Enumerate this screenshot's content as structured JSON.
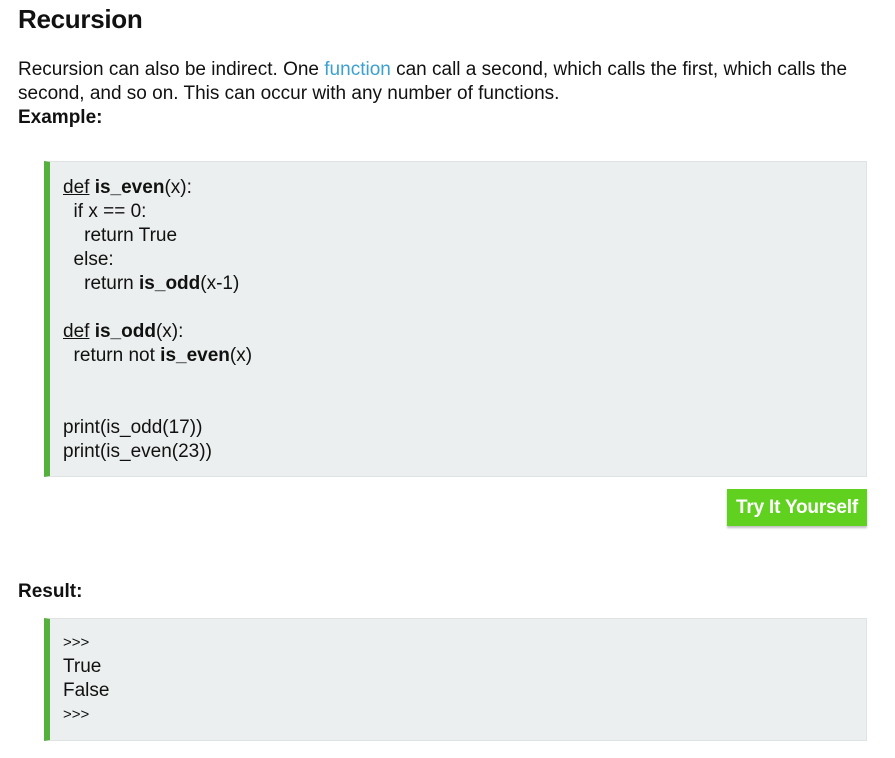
{
  "section": {
    "title": "Recursion",
    "intro_before": "Recursion can also be indirect. One ",
    "intro_link": "function",
    "intro_after": " can call a second, which calls the first, which calls the second, and so on. This can occur with any number of functions.",
    "example_label": "Example:",
    "result_label": "Result:"
  },
  "code": {
    "def_kw": "def",
    "fn_is_even": "is_even",
    "fn_is_odd": "is_odd",
    "line1_tail": "(x):",
    "line2": "  if x == 0:",
    "line3": "    return True",
    "line4": "  else:",
    "line5_pre": "    return ",
    "line5_tail": "(x-1)",
    "line7_tail": "(x):",
    "line8_pre": "  return not ",
    "line8_tail": "(x)",
    "print1": "print(is_odd(17))",
    "print2": "print(is_even(23))"
  },
  "button": {
    "label": "Try It Yourself"
  },
  "result": {
    "prompt1": ">>>",
    "line1": "True",
    "line2": "False",
    "prompt2": ">>>"
  }
}
